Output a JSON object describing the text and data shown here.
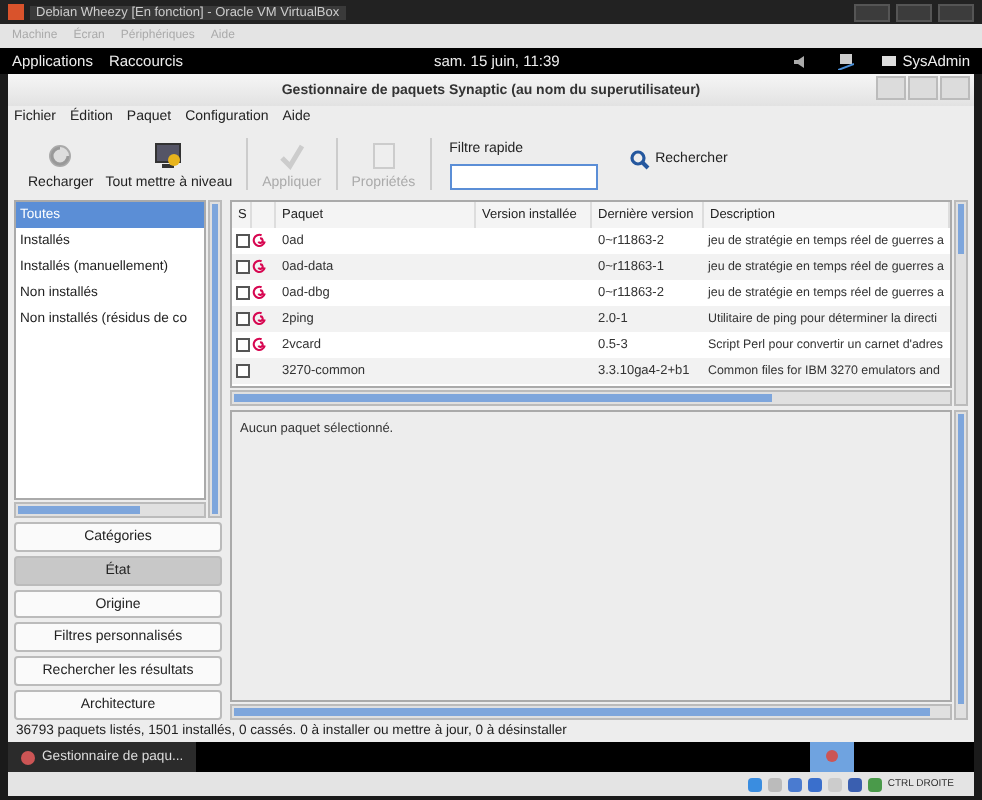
{
  "host_window": {
    "title": "Debian Wheezy [En fonction] - Oracle VM VirtualBox",
    "menu": [
      "Machine",
      "Écran",
      "Périphériques",
      "Aide"
    ],
    "status_label": "CTRL DROITE"
  },
  "top_bar": {
    "menus": [
      "Applications",
      "Raccourcis"
    ],
    "clock": "sam. 15 juin, 11:39",
    "user": "SysAdmin"
  },
  "window": {
    "title": "Gestionnaire de paquets Synaptic  (au nom du superutilisateur)"
  },
  "menu": [
    "Fichier",
    "Édition",
    "Paquet",
    "Configuration",
    "Aide"
  ],
  "toolbar": [
    {
      "label": "Recharger",
      "kind": "reload",
      "disabled": false
    },
    {
      "label": "Tout mettre à niveau",
      "kind": "upgrade",
      "disabled": false
    },
    {
      "label": "Appliquer",
      "kind": "apply",
      "disabled": true
    },
    {
      "label": "Propriétés",
      "kind": "properties",
      "disabled": true
    }
  ],
  "quick_filter": {
    "label": "Filtre rapide"
  },
  "search_button": "Rechercher",
  "filters": [
    {
      "label": "Toutes",
      "selected": true
    },
    {
      "label": "Installés",
      "selected": false
    },
    {
      "label": "Installés (manuellement)",
      "selected": false
    },
    {
      "label": "Non installés",
      "selected": false
    },
    {
      "label": "Non installés (résidus de co",
      "selected": false
    }
  ],
  "filter_buttons": [
    {
      "label": "Catégories",
      "selected": false
    },
    {
      "label": "État",
      "selected": true
    },
    {
      "label": "Origine",
      "selected": false
    },
    {
      "label": "Filtres personnalisés",
      "selected": false
    },
    {
      "label": "Rechercher les résultats",
      "selected": false
    },
    {
      "label": "Architecture",
      "selected": false
    }
  ],
  "table": {
    "columns": [
      "S",
      "Paquet",
      "Version installée",
      "Dernière version",
      "Description"
    ],
    "rows": [
      {
        "checked": false,
        "debian": true,
        "name": "0ad",
        "latest": "0~r11863-2",
        "description": "jeu de stratégie en temps réel de guerres a"
      },
      {
        "checked": false,
        "debian": true,
        "name": "0ad-data",
        "latest": "0~r11863-1",
        "description": "jeu de stratégie en temps réel de guerres a"
      },
      {
        "checked": false,
        "debian": true,
        "name": "0ad-dbg",
        "latest": "0~r11863-2",
        "description": "jeu de stratégie en temps réel de guerres a"
      },
      {
        "checked": false,
        "debian": true,
        "name": "2ping",
        "latest": "2.0-1",
        "description": "Utilitaire de ping pour déterminer la directi"
      },
      {
        "checked": false,
        "debian": true,
        "name": "2vcard",
        "latest": "0.5-3",
        "description": "Script Perl pour convertir un carnet d'adres"
      },
      {
        "checked": false,
        "debian": false,
        "name": "3270-common",
        "latest": "3.3.10ga4-2+b1",
        "description": "Common files for IBM 3270 emulators and"
      }
    ]
  },
  "details": "Aucun paquet sélectionné.",
  "status_bar": "36793 paquets listés, 1501 installés, 0 cassés. 0 à installer ou mettre à jour, 0 à désinstaller",
  "taskbar": [
    {
      "label": "Gestionnaire de paqu...",
      "selected": false
    }
  ]
}
